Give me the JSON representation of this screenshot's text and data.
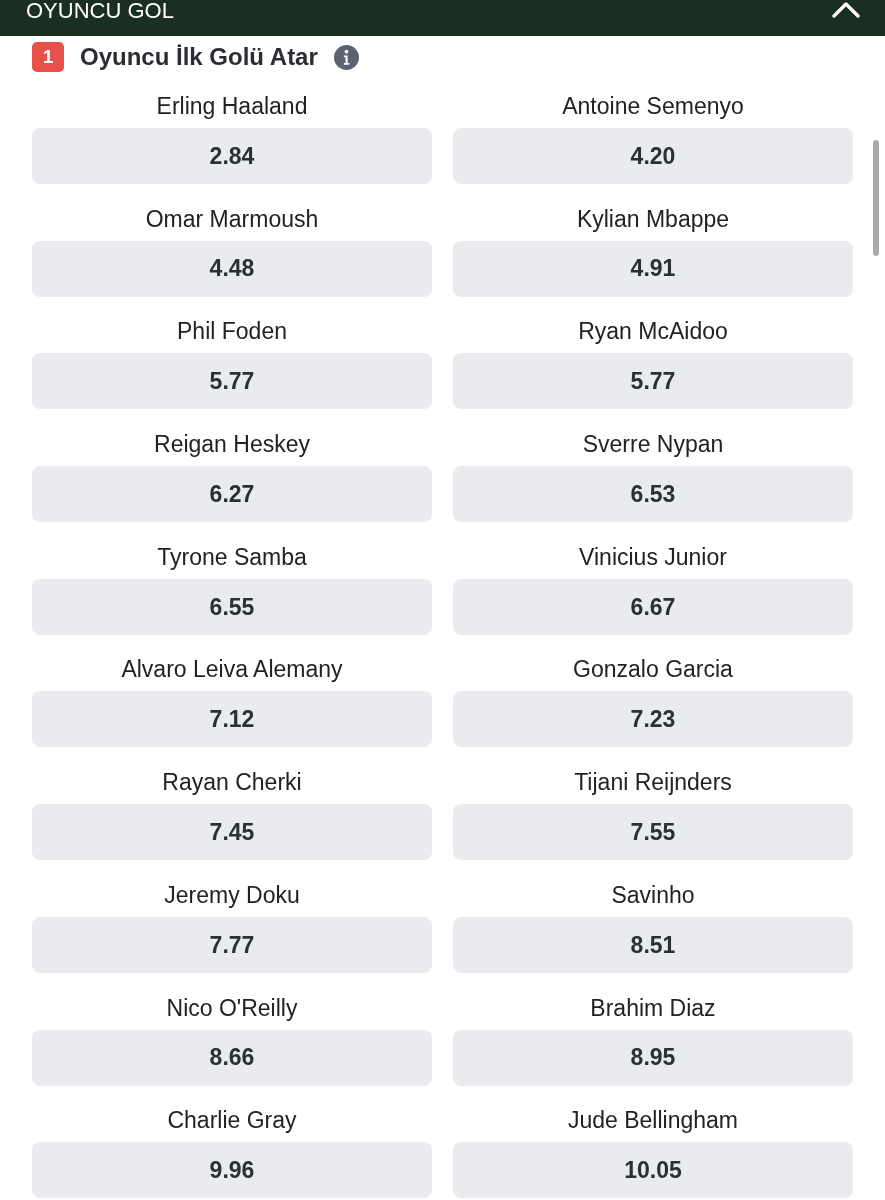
{
  "header": {
    "title": "OYUNCU GOL",
    "expanded": true
  },
  "market": {
    "badge": "1",
    "title": "Oyuncu İlk Golü Atar"
  },
  "selections": [
    {
      "name": "Erling Haaland",
      "odds": "2.84",
      "selected": false
    },
    {
      "name": "Antoine Semenyo",
      "odds": "4.20",
      "selected": false
    },
    {
      "name": "Omar Marmoush",
      "odds": "4.48",
      "selected": false
    },
    {
      "name": "Kylian Mbappe",
      "odds": "4.91",
      "selected": false
    },
    {
      "name": "Phil Foden",
      "odds": "5.77",
      "selected": false
    },
    {
      "name": "Ryan McAidoo",
      "odds": "5.77",
      "selected": false
    },
    {
      "name": "Reigan Heskey",
      "odds": "6.27",
      "selected": false
    },
    {
      "name": "Sverre Nypan",
      "odds": "6.53",
      "selected": false
    },
    {
      "name": "Tyrone Samba",
      "odds": "6.55",
      "selected": false
    },
    {
      "name": "Vinicius Junior",
      "odds": "6.67",
      "selected": false
    },
    {
      "name": "Alvaro Leiva Alemany",
      "odds": "7.12",
      "selected": false
    },
    {
      "name": "Gonzalo Garcia",
      "odds": "7.23",
      "selected": false
    },
    {
      "name": "Rayan Cherki",
      "odds": "7.45",
      "selected": false
    },
    {
      "name": "Tijani Reijnders",
      "odds": "7.55",
      "selected": false
    },
    {
      "name": "Jeremy Doku",
      "odds": "7.77",
      "selected": false
    },
    {
      "name": "Savinho",
      "odds": "8.51",
      "selected": false
    },
    {
      "name": "Nico O'Reilly",
      "odds": "8.66",
      "selected": false
    },
    {
      "name": "Brahim Diaz",
      "odds": "8.95",
      "selected": false
    },
    {
      "name": "Charlie Gray",
      "odds": "9.96",
      "selected": false
    },
    {
      "name": "Jude Bellingham",
      "odds": "10.05",
      "selected": false
    }
  ]
}
